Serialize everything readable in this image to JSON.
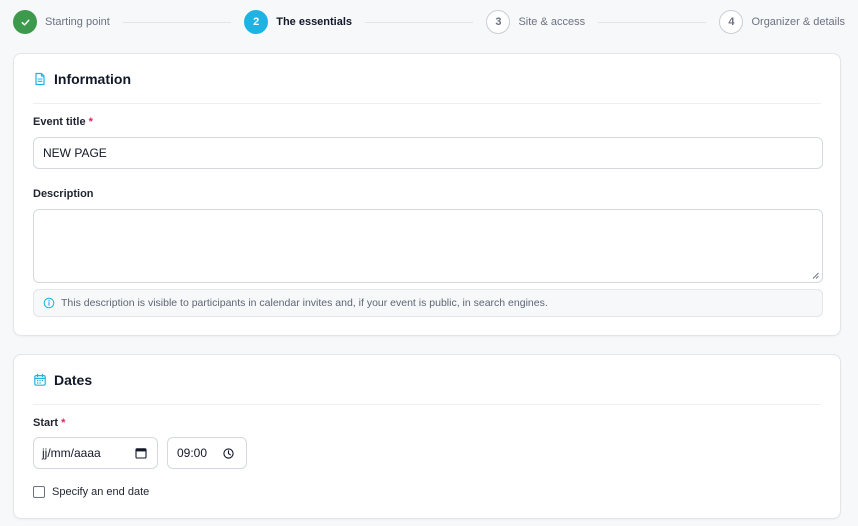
{
  "stepper": {
    "steps": [
      {
        "number": "",
        "label": "Starting point",
        "state": "done"
      },
      {
        "number": "2",
        "label": "The essentials",
        "state": "active"
      },
      {
        "number": "3",
        "label": "Site & access",
        "state": "todo"
      },
      {
        "number": "4",
        "label": "Organizer & details",
        "state": "todo"
      }
    ]
  },
  "information": {
    "title": "Information",
    "icon": "document-icon",
    "event_title_label": "Event title",
    "required_mark": "*",
    "event_title_value": "NEW PAGE",
    "description_label": "Description",
    "description_value": "",
    "description_help": "This description is visible to participants in calendar invites and, if your event is public, in search engines."
  },
  "dates": {
    "title": "Dates",
    "icon": "calendar-icon",
    "start_label": "Start",
    "required_mark": "*",
    "date_placeholder": "jj/mm/aaaa",
    "time_value": "09:00",
    "end_date_label": "Specify an end date",
    "end_date_checked": false
  },
  "colors": {
    "done": "#3d9a4d",
    "active": "#1fb3e3",
    "required": "#e0245e",
    "accent_icon": "#1fb3e3"
  }
}
